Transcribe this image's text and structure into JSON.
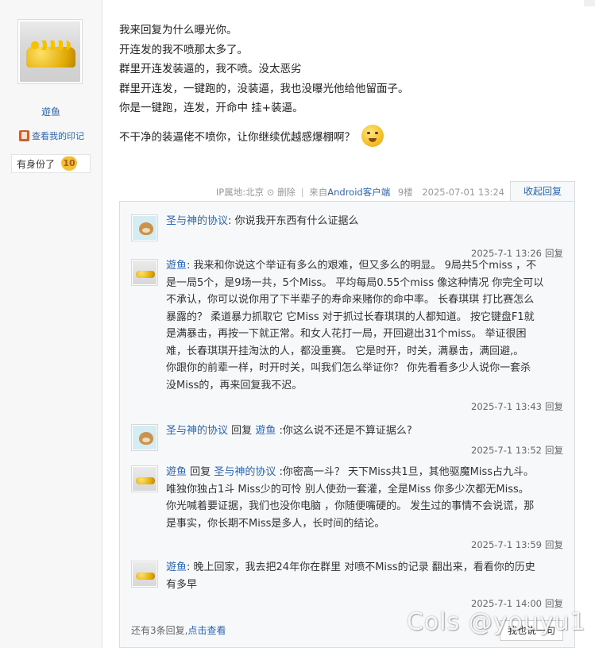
{
  "author": {
    "username": "遊鱼",
    "seal_link": "查看我的印记",
    "rank_label": "有身份了",
    "level": "10"
  },
  "post": {
    "lines": [
      "我来回复为什么曝光你。",
      "开连发的我不喷那太多了。",
      "群里开连发装逼的，我不喷。没太恶劣",
      "群里开连发，一键跑的，没装逼，我也没曝光他给他留面子。",
      "你是一键跑，连发，开命中 挂+装逼。"
    ],
    "last_line": "不干净的装逼佬不喷你，让你继续优越感爆棚啊？",
    "emoji_icon": "blush-emoji-icon"
  },
  "meta": {
    "ip_label": "IP属地:北京",
    "report": "删除",
    "source_prefix": "来自",
    "client": "Android客户端",
    "floor": "9楼",
    "datetime": "2025-07-01 13:24",
    "collapse": "收起回复"
  },
  "replies": [
    {
      "avatar": "cat-avatar-icon",
      "name": "圣与神的协议",
      "lines": [
        "你说我开东西有什么证据么"
      ],
      "time": "2025-7-1 13:26",
      "reply_label": "回复"
    },
    {
      "avatar": "gold-avatar-icon",
      "name": "遊鱼",
      "lines": [
        "我来和你说这个举证有多么的艰难，但又多么的明显。 9局共5个miss ，不",
        "是一局5个，是9场一共，5个Miss。 平均每局0.55个miss 像这种情况 你完全可以",
        "不承认，你可以说你用了下半辈子的寿命来赌你的命中率。 长春琪琪 打比赛怎么",
        "暴露的？ 柔道暴力抓取它 它Miss 对于抓过长春琪琪的人都知道。 按它键盘F1就",
        "是满暴击，再按一下就正常。和女人花打一局，开回避出31个miss。 举证很困",
        "难，长春琪琪开挂淘汰的人，都没重赛。 它是时开，时关，满暴击，满回避,。",
        "你跟你的前辈一样，时开时关，叫我们怎么举证你？ 你先看看多少人说你一套杀",
        "没Miss的，再来回复我不迟。"
      ],
      "time": "2025-7-1 13:43",
      "reply_label": "回复"
    },
    {
      "avatar": "cat-avatar-icon",
      "name": "圣与神的协议",
      "reply_to_prefix": "回复",
      "reply_to": "遊鱼",
      "lines": [
        ":你这么说不还是不算证据么?"
      ],
      "time": "2025-7-1 13:52",
      "reply_label": "回复"
    },
    {
      "avatar": "gold-avatar-icon",
      "name": "遊鱼",
      "reply_to_prefix": "回复",
      "reply_to": "圣与神的协议",
      "lines": [
        ":你密高一斗？ 天下Miss共1旦，其他驱魔Miss占九斗。",
        "唯独你独占1斗 Miss少的可怜 别人使劲一套灌，全是Miss 你多少次都无Miss。",
        "你光喊着要证据，我们也没你电脑 ，你随便嘴硬的。 发生过的事情不会说谎，那",
        "是事实，你长期不Miss是多人，长时间的结论。"
      ],
      "time": "2025-7-1 13:59",
      "reply_label": "回复"
    },
    {
      "avatar": "gold-avatar-icon",
      "name": "遊鱼",
      "lines": [
        "晚上回家，我去把24年你在群里 对喷不Miss的记录 翻出来，看看你的历史",
        "有多早"
      ],
      "time": "2025-7-1 14:00",
      "reply_label": "回复"
    }
  ],
  "more": {
    "prefix": "还有3条回复,",
    "link": "点击查看",
    "reply_button": "我也说一句"
  },
  "watermark": "Cols @youyu1"
}
